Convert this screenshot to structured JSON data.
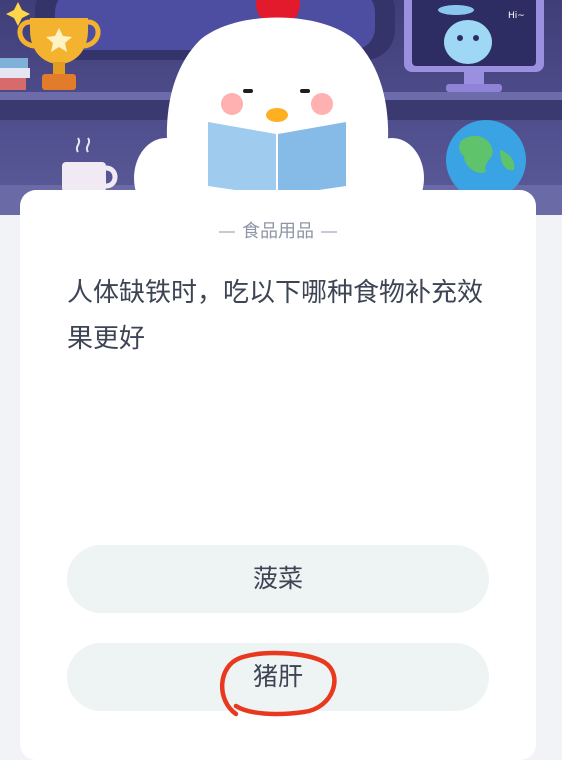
{
  "quiz": {
    "category": "食品用品",
    "question": "人体缺铁时，吃以下哪种食物补充效果更好",
    "options": [
      {
        "label": "菠菜"
      },
      {
        "label": "猪肝"
      }
    ]
  },
  "hero": {
    "monitor_text": "Hi~"
  },
  "colors": {
    "hero_background": "#4a4987",
    "annotation_circle": "#e8391e",
    "option_background": "#eef3f4",
    "text": "#3d4454"
  }
}
